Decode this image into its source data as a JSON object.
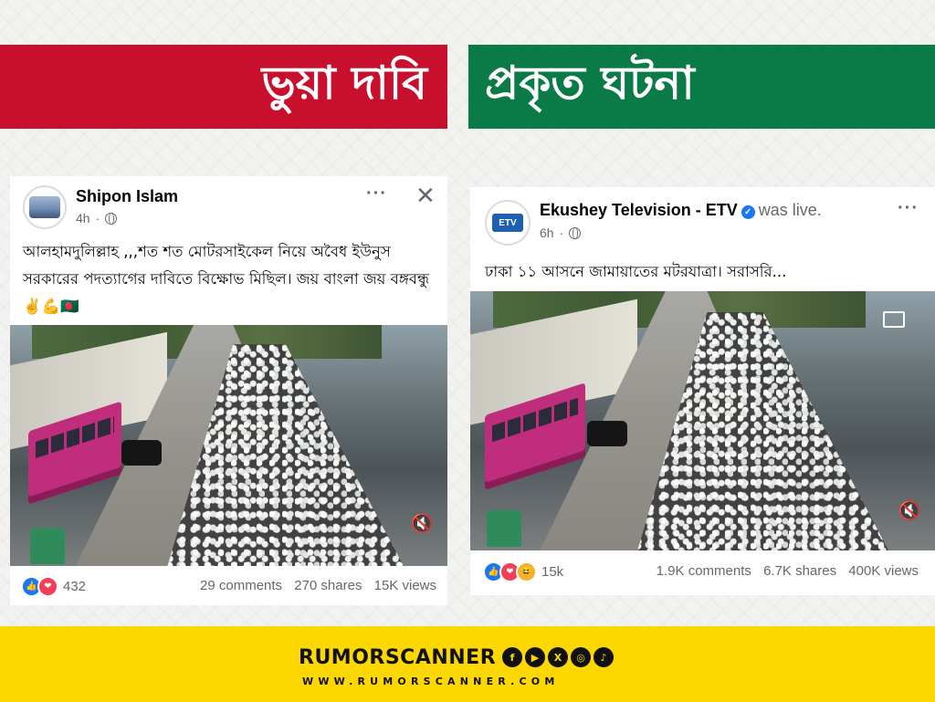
{
  "banners": {
    "fake_claim": "ভুয়া দাবি",
    "actual_event": "প্রকৃত ঘটনা"
  },
  "left_post": {
    "author": "Shipon Islam",
    "time": "4h",
    "text": "আলহামদুলিল্লাহ ,,,শত শত মোটরসাইকেল নিয়ে অবৈধ ইউনুস সরকারের পদত্যাগের দাবিতে বিক্ষোভ মিছিল। জয় বাংলা জয় বঙ্গবন্ধু ✌️💪🇧🇩",
    "reaction_count": "432",
    "comments": "29 comments",
    "shares": "270 shares",
    "views": "15K views"
  },
  "right_post": {
    "author": "Ekushey Television - ETV",
    "status": "was live.",
    "time": "6h",
    "avatar_text": "ETV",
    "text": "ঢাকা ১১ আসনে জামায়াতের মটরযাত্রা। সরাসরি...",
    "reaction_count": "15k",
    "comments": "1.9K comments",
    "shares": "6.7K shares",
    "views": "400K views"
  },
  "icons": {
    "more": "···",
    "close": "✕",
    "mute": "🔇",
    "verified": "✓",
    "like": "👍",
    "love": "❤",
    "haha": "😆"
  },
  "footer": {
    "brand": "RUMORSCANNER",
    "website": "WWW.RUMORSCANNER.COM",
    "social": [
      "f",
      "▶",
      "X",
      "◎",
      "♪"
    ]
  },
  "colors": {
    "fake_banner": "#c8102e",
    "real_banner": "#0a7a47",
    "footer_bg": "#fdd800",
    "facebook_blue": "#1877f2"
  }
}
